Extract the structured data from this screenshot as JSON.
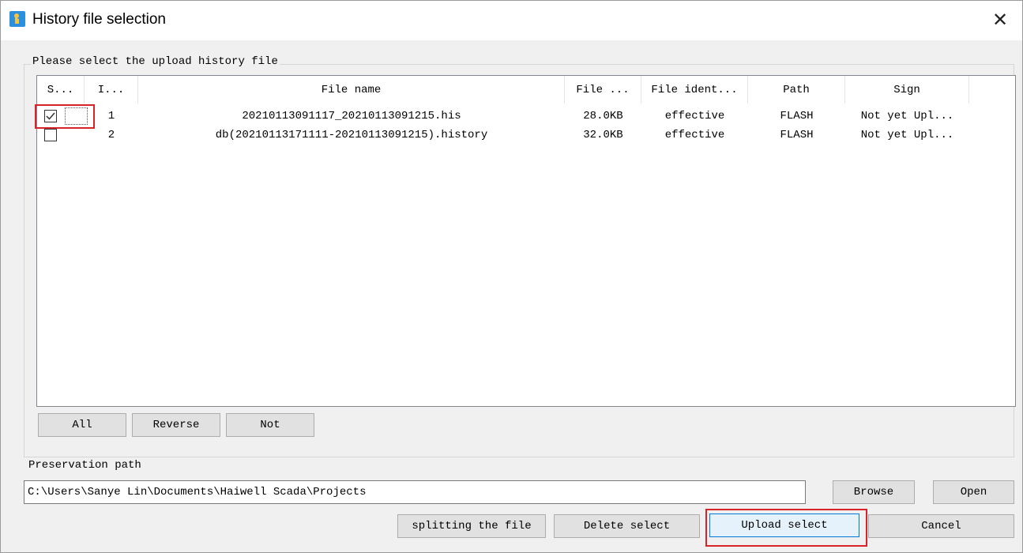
{
  "window": {
    "title": "History file selection"
  },
  "group": {
    "label": "Please select the upload history file"
  },
  "table": {
    "columns": [
      "S...",
      "I...",
      "File name",
      "File ...",
      "File ident...",
      "Path",
      "Sign"
    ],
    "rows": [
      {
        "selected": true,
        "index": "1",
        "file_name": "20210113091117_20210113091215.his",
        "size": "28.0KB",
        "ident": "effective",
        "path": "FLASH",
        "sign": "Not yet Upl..."
      },
      {
        "selected": false,
        "index": "2",
        "file_name": "db(20210113171111-20210113091215).history",
        "size": "32.0KB",
        "ident": "effective",
        "path": "FLASH",
        "sign": "Not yet Upl..."
      }
    ]
  },
  "selection_buttons": {
    "all": "All",
    "reverse": "Reverse",
    "not": "Not"
  },
  "preservation": {
    "label": "Preservation path",
    "value": "C:\\Users\\Sanye Lin\\Documents\\Haiwell Scada\\Projects"
  },
  "path_buttons": {
    "browse": "Browse",
    "open": "Open"
  },
  "actions": {
    "split": "splitting the file",
    "delete": "Delete select",
    "upload": "Upload select",
    "cancel": "Cancel"
  },
  "colors": {
    "highlight": "#d9232b",
    "primary_border": "#0078d7"
  }
}
